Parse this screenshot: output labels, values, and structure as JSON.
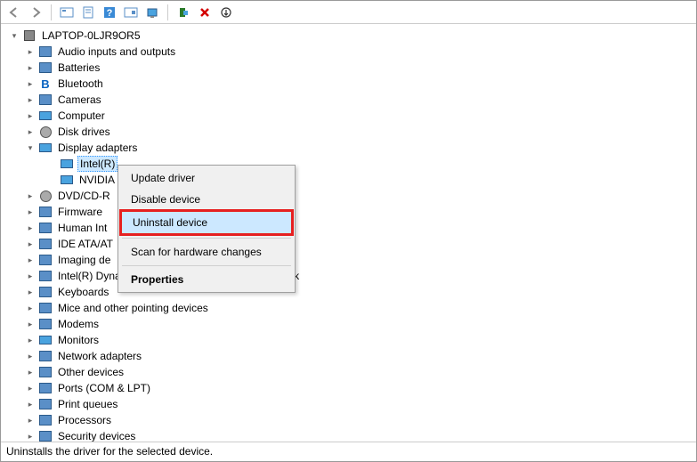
{
  "toolbar": {
    "icons": [
      "back",
      "forward",
      "sep",
      "show-hidden",
      "properties",
      "help",
      "update",
      "computer",
      "sep",
      "add-legacy",
      "remove",
      "more"
    ]
  },
  "root": {
    "label": "LAPTOP-0LJR9OR5"
  },
  "categories": [
    {
      "label": "Audio inputs and outputs",
      "expanded": false,
      "icon": "audio"
    },
    {
      "label": "Batteries",
      "expanded": false,
      "icon": "battery"
    },
    {
      "label": "Bluetooth",
      "expanded": false,
      "icon": "bluetooth"
    },
    {
      "label": "Cameras",
      "expanded": false,
      "icon": "camera"
    },
    {
      "label": "Computer",
      "expanded": false,
      "icon": "computer"
    },
    {
      "label": "Disk drives",
      "expanded": false,
      "icon": "disk"
    },
    {
      "label": "Display adapters",
      "expanded": true,
      "icon": "display",
      "children": [
        {
          "label": "Intel(R)",
          "selected": true
        },
        {
          "label": "NVIDIA"
        }
      ]
    },
    {
      "label": "DVD/CD-R",
      "expanded": false,
      "icon": "dvd",
      "truncated": true
    },
    {
      "label": "Firmware",
      "expanded": false,
      "icon": "firmware",
      "truncated": true
    },
    {
      "label": "Human Int",
      "expanded": false,
      "icon": "hid",
      "truncated": true
    },
    {
      "label": "IDE ATA/AT",
      "expanded": false,
      "icon": "ide",
      "truncated": true
    },
    {
      "label": "Imaging de",
      "expanded": false,
      "icon": "imaging",
      "truncated": true
    },
    {
      "label": "Intel(R) Dynamic Platform and Thermal Framework",
      "expanded": false,
      "icon": "chip"
    },
    {
      "label": "Keyboards",
      "expanded": false,
      "icon": "keyboard"
    },
    {
      "label": "Mice and other pointing devices",
      "expanded": false,
      "icon": "mouse"
    },
    {
      "label": "Modems",
      "expanded": false,
      "icon": "modem"
    },
    {
      "label": "Monitors",
      "expanded": false,
      "icon": "monitor"
    },
    {
      "label": "Network adapters",
      "expanded": false,
      "icon": "network"
    },
    {
      "label": "Other devices",
      "expanded": false,
      "icon": "other"
    },
    {
      "label": "Ports (COM & LPT)",
      "expanded": false,
      "icon": "port"
    },
    {
      "label": "Print queues",
      "expanded": false,
      "icon": "printer"
    },
    {
      "label": "Processors",
      "expanded": false,
      "icon": "cpu"
    },
    {
      "label": "Security devices",
      "expanded": false,
      "icon": "security"
    }
  ],
  "context_menu": {
    "items": [
      {
        "label": "Update driver",
        "type": "item"
      },
      {
        "label": "Disable device",
        "type": "item"
      },
      {
        "label": "Uninstall device",
        "type": "item",
        "highlighted": true
      },
      {
        "type": "sep"
      },
      {
        "label": "Scan for hardware changes",
        "type": "item"
      },
      {
        "type": "sep"
      },
      {
        "label": "Properties",
        "type": "item",
        "bold": true
      }
    ]
  },
  "statusbar": {
    "text": "Uninstalls the driver for the selected device."
  }
}
